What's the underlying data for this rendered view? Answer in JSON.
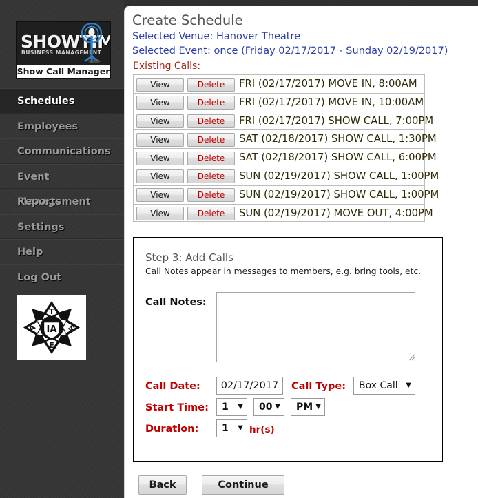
{
  "brand": {
    "logo_word": "SHOWTIME",
    "logo_subtitle": "BUSINESS MANAGEMENT",
    "logo_caption": "Show Call Manager",
    "union_logo_letters": [
      "T",
      "S",
      "E",
      "I",
      "A"
    ],
    "union_logo_center": "IA"
  },
  "sidebar": {
    "items": [
      {
        "label": "Schedules",
        "active": true
      },
      {
        "label": "Employees",
        "active": false
      },
      {
        "label": "Communications",
        "active": false
      },
      {
        "label": "Event Management",
        "active": false
      },
      {
        "label": "Reports",
        "active": false
      },
      {
        "label": "Settings",
        "active": false
      },
      {
        "label": "Help",
        "active": false
      },
      {
        "label": "Log Out",
        "active": false
      }
    ]
  },
  "header": {
    "title": "Create Schedule",
    "selected_venue": "Selected Venue: Hanover Theatre",
    "selected_event": "Selected Event: once (Friday 02/17/2017 - Sunday 02/19/2017)",
    "existing_calls_label": "Existing Calls:"
  },
  "calls": {
    "view_label": "View",
    "delete_label": "Delete",
    "rows": [
      {
        "text": "FRI (02/17/2017) MOVE IN, 8:00AM"
      },
      {
        "text": "FRI (02/17/2017) MOVE IN, 10:00AM"
      },
      {
        "text": "FRI (02/17/2017) SHOW CALL, 7:00PM"
      },
      {
        "text": "SAT (02/18/2017) SHOW CALL, 1:30PM"
      },
      {
        "text": "SAT (02/18/2017) SHOW CALL, 6:00PM"
      },
      {
        "text": "SUN (02/19/2017) SHOW CALL, 1:00PM"
      },
      {
        "text": "SUN (02/19/2017) SHOW CALL, 1:00PM"
      },
      {
        "text": "SUN (02/19/2017) MOVE OUT, 4:00PM"
      }
    ]
  },
  "step": {
    "title": "Step 3: Add Calls",
    "hint": "Call Notes appear in messages to members, e.g. bring tools, etc.",
    "call_notes_label": "Call Notes:",
    "call_notes_value": "",
    "call_notes_placeholder": "",
    "call_date_label": "Call Date:",
    "call_date_value": "02/17/2017",
    "call_type_label": "Call Type:",
    "call_type_value": "Box Call",
    "start_time_label": "Start Time:",
    "start_hour_value": "1",
    "start_minute_value": "00",
    "start_ampm_value": "PM",
    "duration_label": "Duration:",
    "duration_value": "1",
    "duration_unit": "hr(s)",
    "caret_glyph": "▼"
  },
  "footer": {
    "back_label": "Back",
    "continue_label": "Continue"
  },
  "colors": {
    "accent_red": "#c00000",
    "link_blue": "#2b3ea8",
    "existing_label_red": "#9d2a14",
    "call_text": "#2e2a06",
    "sidebar_bg": "#373737",
    "panel_bg": "#ffffff"
  }
}
